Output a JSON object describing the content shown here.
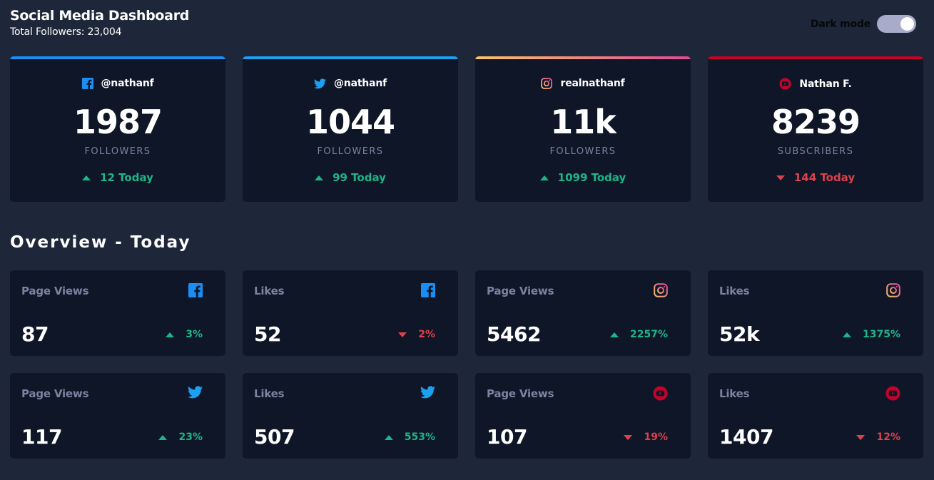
{
  "header": {
    "title": "Social Media Dashboard",
    "total_followers": "Total Followers: 23,004",
    "dark_mode_label": "Dark mode",
    "dark_mode_on": true
  },
  "colors": {
    "facebook": "#198ff5",
    "twitter": "#1ca0f2",
    "instagram_start": "#fdc468",
    "instagram_end": "#df4996",
    "youtube": "#c4032a",
    "up": "#1eb589",
    "down": "#dc414c"
  },
  "cards": [
    {
      "network": "facebook",
      "icon": "facebook-icon",
      "handle": "@nathanf",
      "count": "1987",
      "kind": "FOLLOWERS",
      "delta": "12 Today",
      "trend": "up"
    },
    {
      "network": "twitter",
      "icon": "twitter-icon",
      "handle": "@nathanf",
      "count": "1044",
      "kind": "FOLLOWERS",
      "delta": "99 Today",
      "trend": "up"
    },
    {
      "network": "instagram",
      "icon": "instagram-icon",
      "handle": "realnathanf",
      "count": "11k",
      "kind": "FOLLOWERS",
      "delta": "1099 Today",
      "trend": "up"
    },
    {
      "network": "youtube",
      "icon": "youtube-icon",
      "handle": "Nathan F.",
      "count": "8239",
      "kind": "SUBSCRIBERS",
      "delta": "144 Today",
      "trend": "down"
    }
  ],
  "overview": {
    "title": "Overview - Today",
    "items": [
      {
        "label": "Page Views",
        "network": "facebook",
        "icon": "facebook-icon",
        "value": "87",
        "delta": "3%",
        "trend": "up"
      },
      {
        "label": "Likes",
        "network": "facebook",
        "icon": "facebook-icon",
        "value": "52",
        "delta": "2%",
        "trend": "down"
      },
      {
        "label": "Page Views",
        "network": "instagram",
        "icon": "instagram-icon",
        "value": "5462",
        "delta": "2257%",
        "trend": "up"
      },
      {
        "label": "Likes",
        "network": "instagram",
        "icon": "instagram-icon",
        "value": "52k",
        "delta": "1375%",
        "trend": "up"
      },
      {
        "label": "Page Views",
        "network": "twitter",
        "icon": "twitter-icon",
        "value": "117",
        "delta": "23%",
        "trend": "up"
      },
      {
        "label": "Likes",
        "network": "twitter",
        "icon": "twitter-icon",
        "value": "507",
        "delta": "553%",
        "trend": "up"
      },
      {
        "label": "Page Views",
        "network": "youtube",
        "icon": "youtube-icon",
        "value": "107",
        "delta": "19%",
        "trend": "down"
      },
      {
        "label": "Likes",
        "network": "youtube",
        "icon": "youtube-icon",
        "value": "1407",
        "delta": "12%",
        "trend": "down"
      }
    ]
  }
}
